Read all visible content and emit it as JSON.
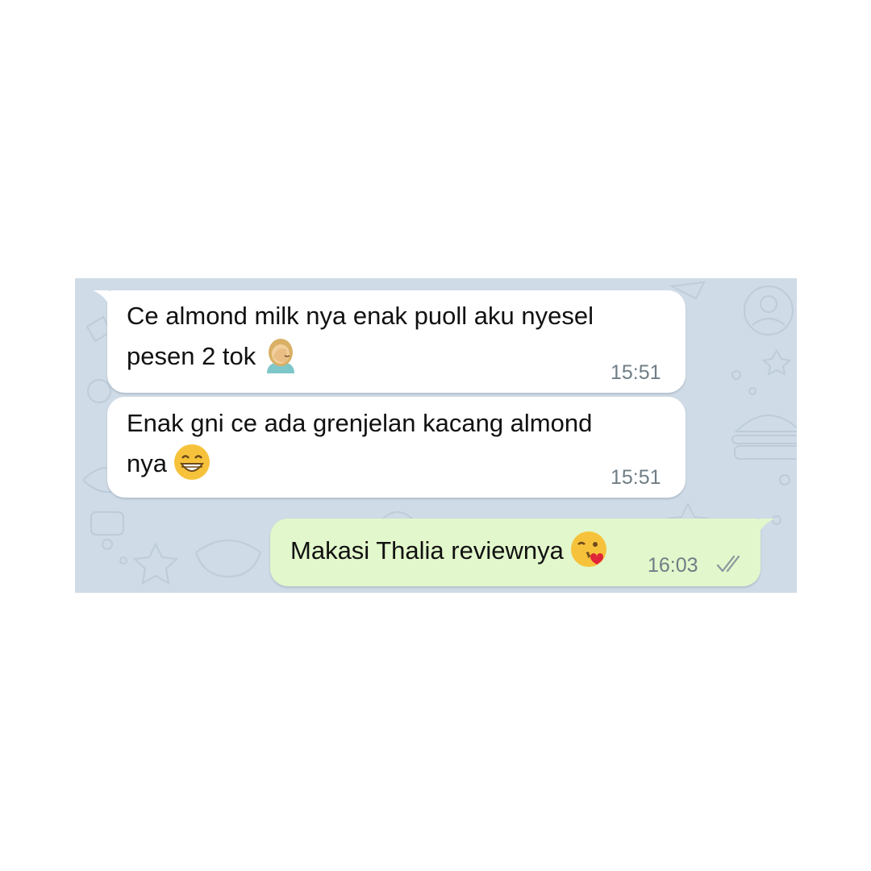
{
  "messages": [
    {
      "direction": "incoming",
      "line1": "Ce almond milk nya enak puoll aku nyesel",
      "line2": "pesen 2 tok",
      "emoji": "woman-facepalming-icon",
      "time": "15:51"
    },
    {
      "direction": "incoming",
      "line1": "Enak gni ce ada grenjelan kacang almond",
      "line2": "nya",
      "emoji": "grinning-face-icon",
      "time": "15:51"
    },
    {
      "direction": "outgoing",
      "line1": "Makasi Thalia reviewnya",
      "emoji": "face-blowing-kiss-icon",
      "time": "16:03",
      "status": "read-double-check-icon"
    }
  ],
  "colors": {
    "wallpaper": "#cfdbe6",
    "incoming_bubble": "#ffffff",
    "outgoing_bubble": "#e2f7cb",
    "timestamp": "#6f7d86"
  }
}
